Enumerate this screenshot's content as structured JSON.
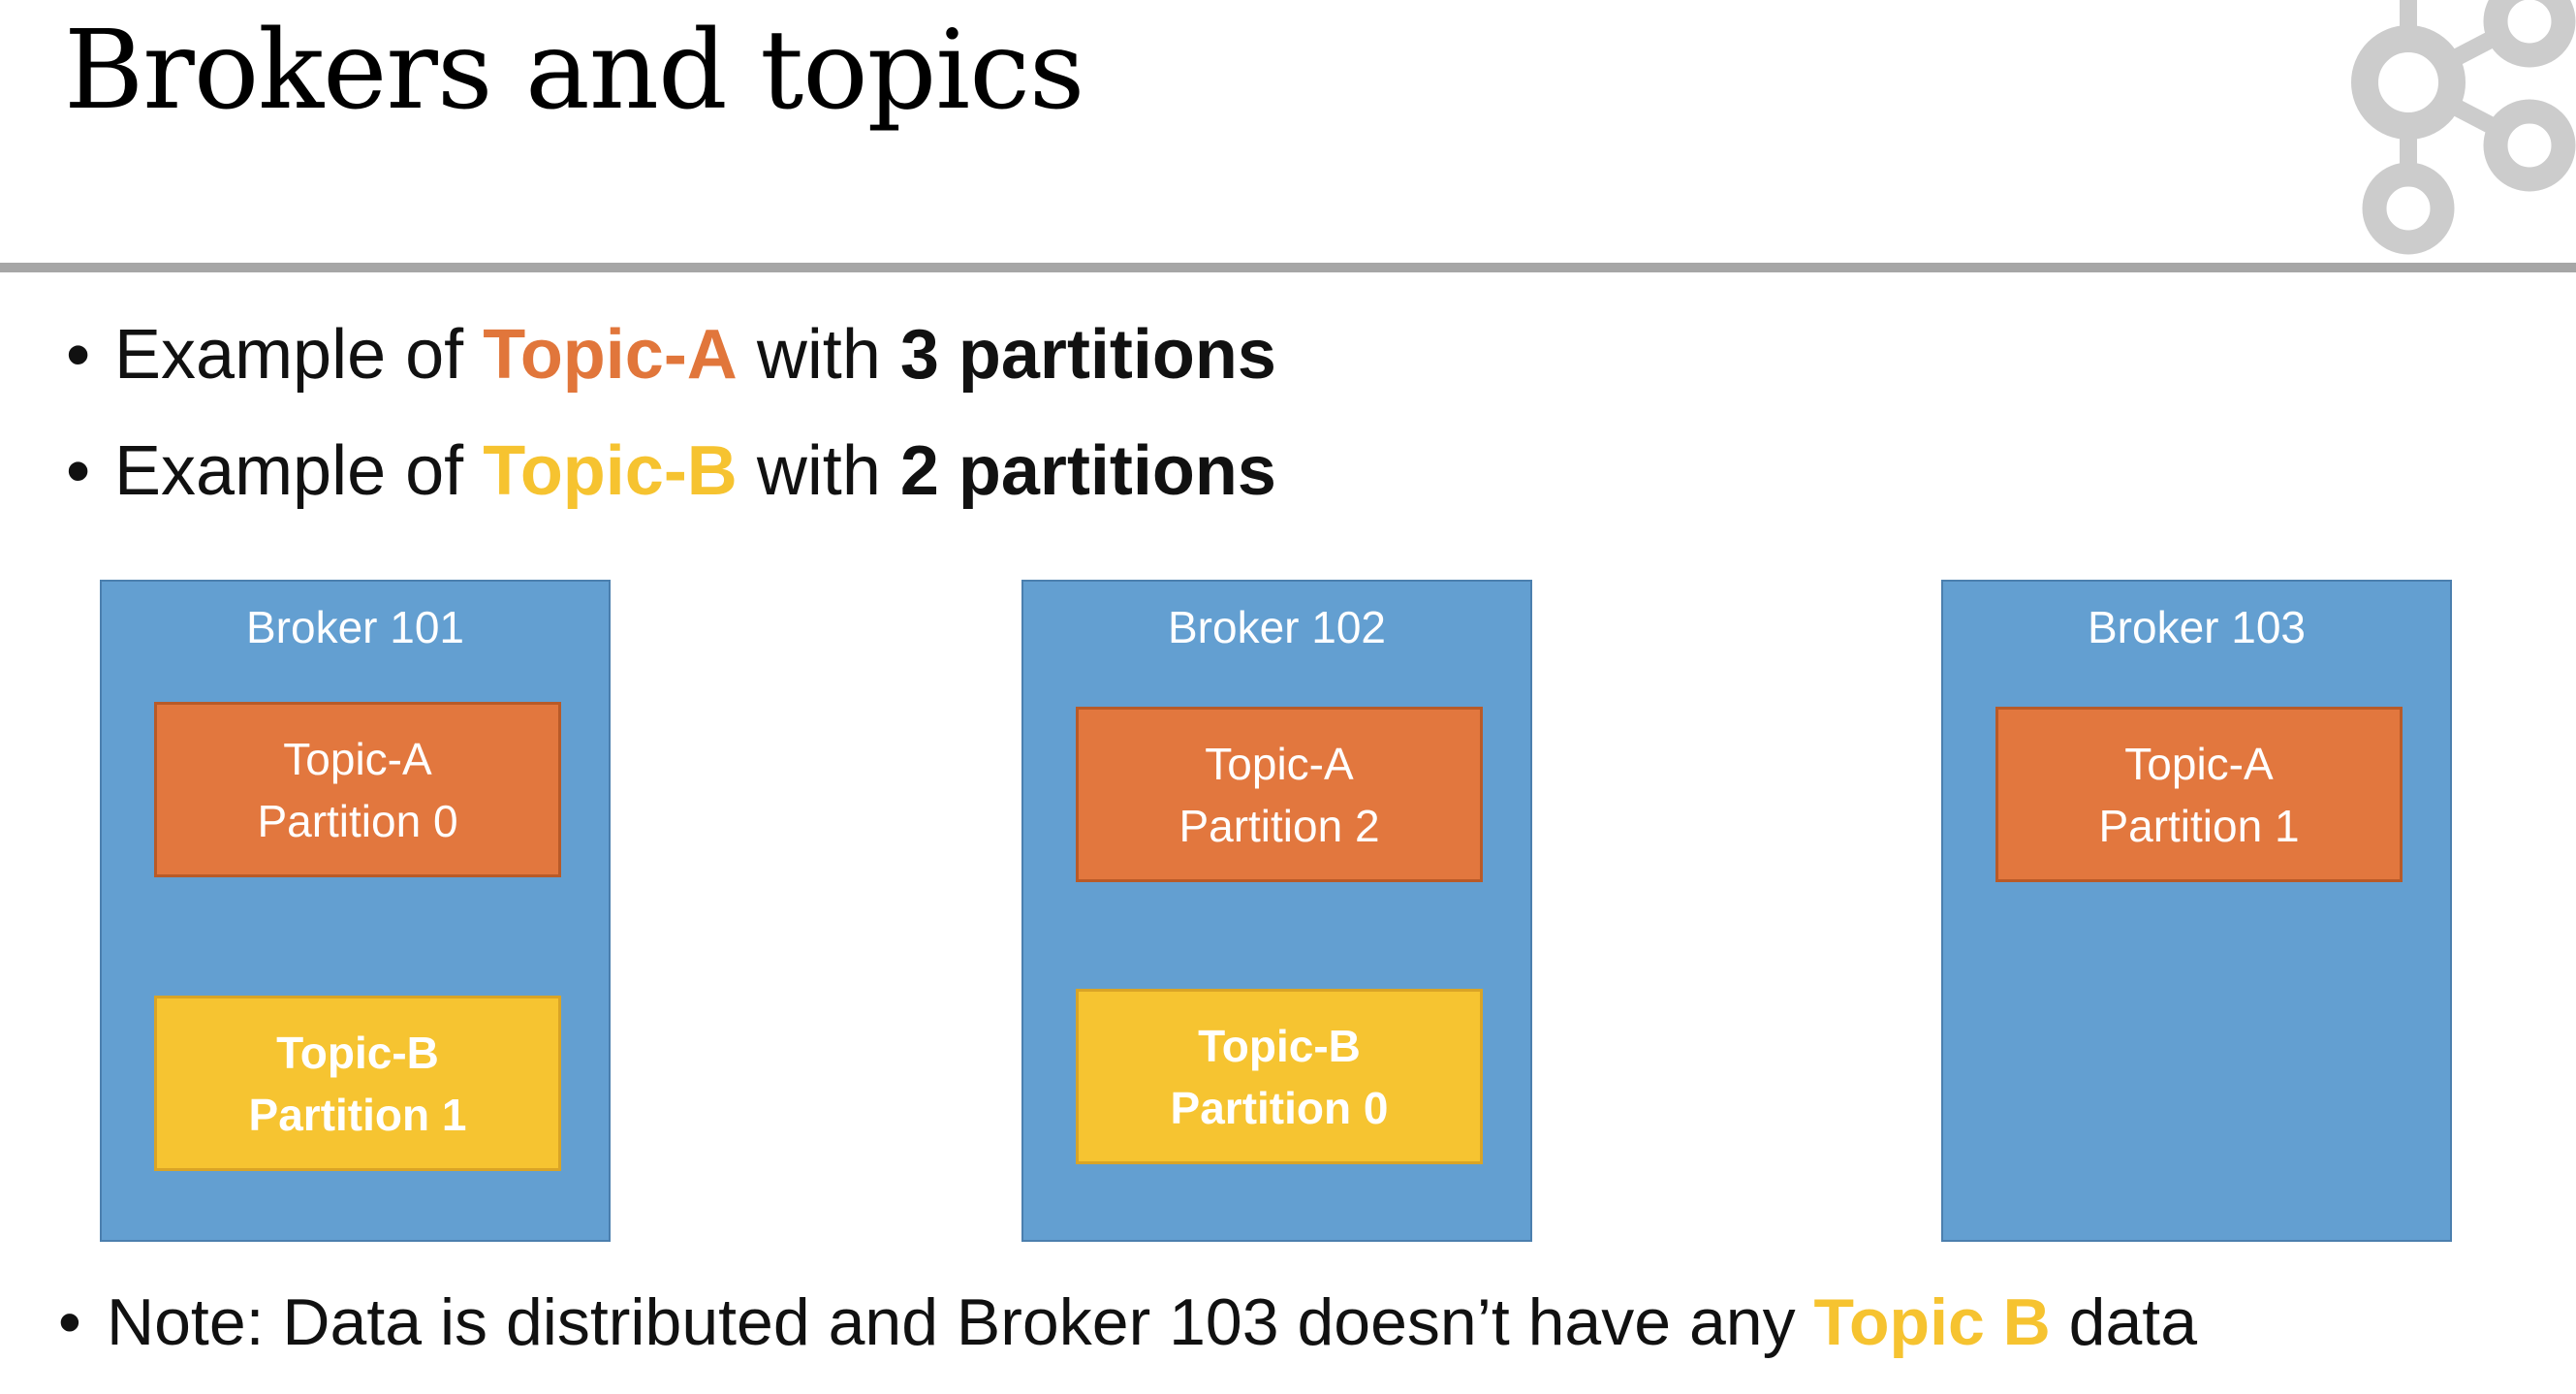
{
  "title": "Brokers and topics",
  "bullets": [
    {
      "prefix": "Example of ",
      "topic": "Topic-A",
      "mid": " with ",
      "count": "3 partitions"
    },
    {
      "prefix": "Example of ",
      "topic": "Topic-B",
      "mid": " with ",
      "count": "2 partitions"
    }
  ],
  "brokers": [
    {
      "label": "Broker 101",
      "partitions": [
        {
          "topic": "Topic-A",
          "partition": "Partition 0"
        },
        {
          "topic": "Topic-B",
          "partition": "Partition 1"
        }
      ]
    },
    {
      "label": "Broker 102",
      "partitions": [
        {
          "topic": "Topic-A",
          "partition": "Partition 2"
        },
        {
          "topic": "Topic-B",
          "partition": "Partition 0"
        }
      ]
    },
    {
      "label": "Broker 103",
      "partitions": [
        {
          "topic": "Topic-A",
          "partition": "Partition 1"
        }
      ]
    }
  ],
  "note": {
    "prefix": "Note: Data is distributed and Broker 103 doesn’t have any ",
    "topic": "Topic B",
    "suffix": " data"
  },
  "colors": {
    "topic_a": "#e2773e",
    "topic_b": "#f6c431",
    "broker": "#639fd1",
    "logo": "#cccccc"
  }
}
